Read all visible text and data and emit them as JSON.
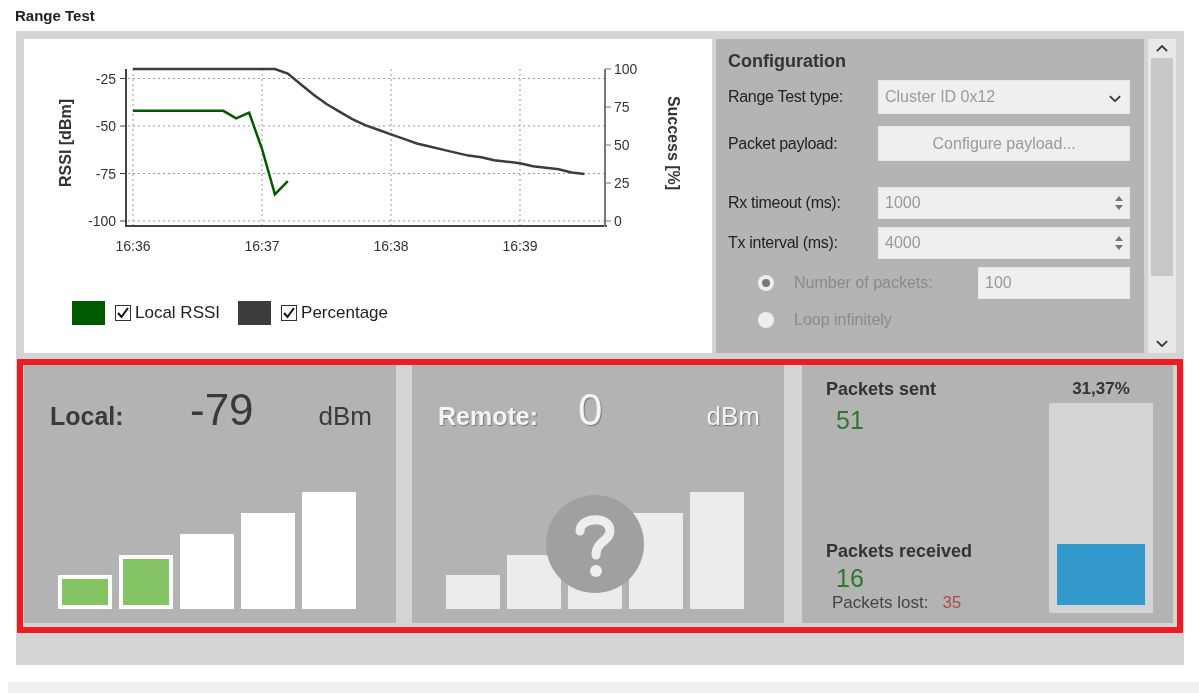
{
  "title": "Range Test",
  "chart": {
    "legend": [
      {
        "checked": true
      },
      {
        "checked": true
      }
    ],
    "chart_data": {
      "type": "line",
      "grid": true,
      "ylabel": "RSSI [dBm]",
      "y2label": "Success [%]",
      "ylim": [
        -100,
        -20
      ],
      "y2lim": [
        0,
        100
      ],
      "yticks": [
        -100,
        -75,
        -50,
        -25
      ],
      "y2ticks": [
        0,
        25,
        50,
        75,
        100
      ],
      "categories": [
        "16:36",
        null,
        null,
        null,
        null,
        null,
        null,
        null,
        null,
        null,
        "16:37",
        null,
        null,
        null,
        null,
        null,
        null,
        null,
        null,
        null,
        "16:38",
        null,
        null,
        null,
        null,
        null,
        null,
        null,
        null,
        null,
        "16:39",
        null,
        null,
        null,
        null,
        null,
        null
      ],
      "series": [
        {
          "name": "Local RSSI",
          "color": "#005a00",
          "values": [
            -42,
            -42,
            -42,
            -42,
            -42,
            -42,
            -42,
            -42,
            -46,
            -43,
            -62,
            -86,
            -79,
            null,
            null,
            null,
            null,
            null,
            null,
            null,
            null,
            null,
            null,
            null,
            null,
            null,
            null,
            null,
            null,
            null,
            null,
            null,
            null,
            null,
            null,
            null,
            null
          ]
        },
        {
          "name": "Percentage",
          "color": "#3c3c3c",
          "axis": "y2",
          "values": [
            100,
            100,
            100,
            100,
            100,
            100,
            100,
            100,
            100,
            100,
            100,
            100,
            97,
            90,
            83,
            77,
            72,
            67,
            63,
            60,
            57,
            54,
            51,
            49,
            47,
            45,
            43,
            42,
            40,
            39,
            38,
            36,
            35,
            34,
            32,
            31,
            null
          ]
        }
      ]
    }
  },
  "configuration": {
    "title": "Configuration",
    "fields": [
      {
        "kind": "dropdown",
        "label": "Range Test type:",
        "value": "Cluster ID 0x12"
      },
      {
        "kind": "button",
        "label": "Packet payload:",
        "value": "Configure payload..."
      },
      {
        "kind": "spinner",
        "label": "Rx timeout (ms):",
        "value": "1000"
      },
      {
        "kind": "spinner",
        "label": "Tx interval (ms):",
        "value": "4000"
      }
    ],
    "options": [
      {
        "label": "Number of packets:",
        "selected": true,
        "value": "100"
      },
      {
        "label": "Loop infinitely",
        "selected": false
      }
    ]
  },
  "signals": [
    {
      "label": "Local:",
      "value": "-79",
      "unit": "dBm",
      "level": 0.4,
      "disabled": false
    },
    {
      "label": "Remote:",
      "value": "0",
      "unit": "dBm",
      "level": 0,
      "disabled": true
    }
  ],
  "packets": {
    "sent_label": "Packets sent",
    "sent": "51",
    "received_label": "Packets received",
    "received": "16",
    "lost_label": "Packets lost:",
    "lost": "35",
    "percentage": "31,37%"
  }
}
